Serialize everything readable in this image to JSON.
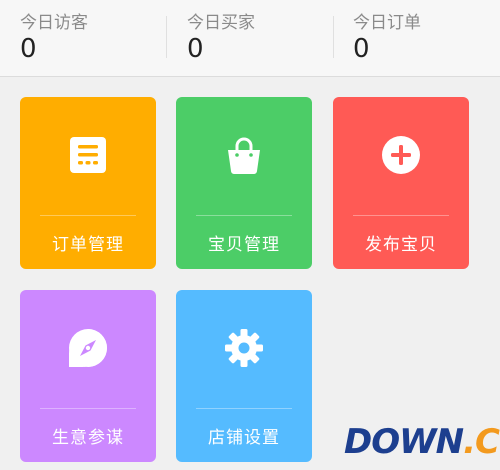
{
  "stats": [
    {
      "label": "今日访客",
      "value": "0"
    },
    {
      "label": "今日买家",
      "value": "0"
    },
    {
      "label": "今日订单",
      "value": "0"
    }
  ],
  "tiles": [
    {
      "label": "订单管理",
      "icon": "order-list-icon",
      "color": "#ffad00"
    },
    {
      "label": "宝贝管理",
      "icon": "shopping-bag-icon",
      "color": "#4ccd67"
    },
    {
      "label": "发布宝贝",
      "icon": "plus-circle-icon",
      "color": "#ff5a55"
    },
    {
      "label": "生意参谋",
      "icon": "compass-icon",
      "color": "#cc88ff"
    },
    {
      "label": "店铺设置",
      "icon": "gear-icon",
      "color": "#55bbff"
    }
  ],
  "watermark": {
    "brand": "DOWN",
    "suffix": ".CC"
  }
}
